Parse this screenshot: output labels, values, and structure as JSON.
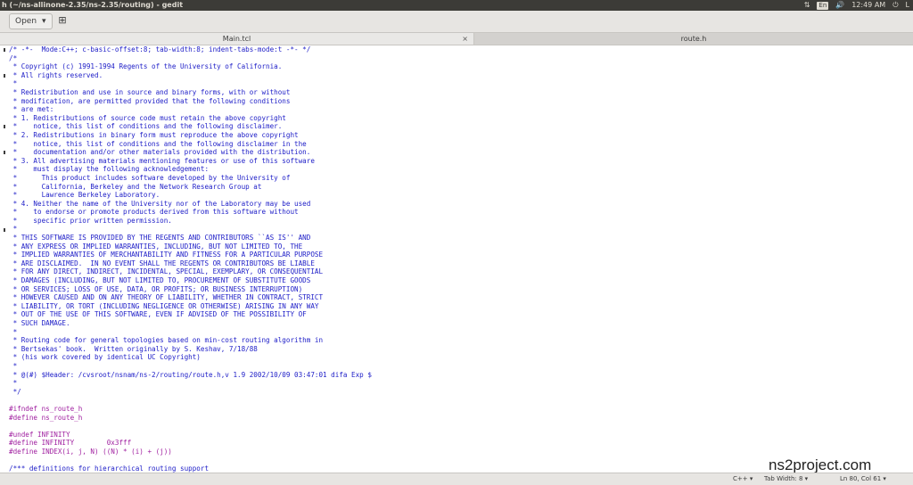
{
  "window": {
    "title": "h (~/ns-allinone-2.35/ns-2.35/routing) - gedit"
  },
  "tray": {
    "sort_icon": "⇅",
    "keyboard": "En",
    "volume_icon": "🔊",
    "time": "12:49 AM",
    "power_icon": "⏻",
    "user_initial": "L"
  },
  "toolbar": {
    "open_label": "Open",
    "open_caret": "▾",
    "new_icon": "⊞"
  },
  "tabs": [
    {
      "label": "Main.tcl",
      "close": "×",
      "active": true
    },
    {
      "label": "route.h",
      "active": false
    }
  ],
  "code_lines": [
    {
      "text": "/* -*-  Mode:C++; c-basic-offset:8; tab-width:8; indent-tabs-mode:t -*- */",
      "kind": "comment"
    },
    {
      "text": "/*",
      "kind": "comment"
    },
    {
      "text": " * Copyright (c) 1991-1994 Regents of the University of California.",
      "kind": "comment"
    },
    {
      "text": " * All rights reserved.",
      "kind": "comment"
    },
    {
      "text": " *",
      "kind": "comment"
    },
    {
      "text": " * Redistribution and use in source and binary forms, with or without",
      "kind": "comment"
    },
    {
      "text": " * modification, are permitted provided that the following conditions",
      "kind": "comment"
    },
    {
      "text": " * are met:",
      "kind": "comment"
    },
    {
      "text": " * 1. Redistributions of source code must retain the above copyright",
      "kind": "comment"
    },
    {
      "text": " *    notice, this list of conditions and the following disclaimer.",
      "kind": "comment"
    },
    {
      "text": " * 2. Redistributions in binary form must reproduce the above copyright",
      "kind": "comment"
    },
    {
      "text": " *    notice, this list of conditions and the following disclaimer in the",
      "kind": "comment"
    },
    {
      "text": " *    documentation and/or other materials provided with the distribution.",
      "kind": "comment"
    },
    {
      "text": " * 3. All advertising materials mentioning features or use of this software",
      "kind": "comment"
    },
    {
      "text": " *    must display the following acknowledgement:",
      "kind": "comment"
    },
    {
      "text": " *      This product includes software developed by the University of",
      "kind": "comment"
    },
    {
      "text": " *      California, Berkeley and the Network Research Group at",
      "kind": "comment"
    },
    {
      "text": " *      Lawrence Berkeley Laboratory.",
      "kind": "comment"
    },
    {
      "text": " * 4. Neither the name of the University nor of the Laboratory may be used",
      "kind": "comment"
    },
    {
      "text": " *    to endorse or promote products derived from this software without",
      "kind": "comment"
    },
    {
      "text": " *    specific prior written permission.",
      "kind": "comment"
    },
    {
      "text": " *",
      "kind": "comment"
    },
    {
      "text": " * THIS SOFTWARE IS PROVIDED BY THE REGENTS AND CONTRIBUTORS ``AS IS'' AND",
      "kind": "comment"
    },
    {
      "text": " * ANY EXPRESS OR IMPLIED WARRANTIES, INCLUDING, BUT NOT LIMITED TO, THE",
      "kind": "comment"
    },
    {
      "text": " * IMPLIED WARRANTIES OF MERCHANTABILITY AND FITNESS FOR A PARTICULAR PURPOSE",
      "kind": "comment"
    },
    {
      "text": " * ARE DISCLAIMED.  IN NO EVENT SHALL THE REGENTS OR CONTRIBUTORS BE LIABLE",
      "kind": "comment"
    },
    {
      "text": " * FOR ANY DIRECT, INDIRECT, INCIDENTAL, SPECIAL, EXEMPLARY, OR CONSEQUENTIAL",
      "kind": "comment"
    },
    {
      "text": " * DAMAGES (INCLUDING, BUT NOT LIMITED TO, PROCUREMENT OF SUBSTITUTE GOODS",
      "kind": "comment"
    },
    {
      "text": " * OR SERVICES; LOSS OF USE, DATA, OR PROFITS; OR BUSINESS INTERRUPTION)",
      "kind": "comment"
    },
    {
      "text": " * HOWEVER CAUSED AND ON ANY THEORY OF LIABILITY, WHETHER IN CONTRACT, STRICT",
      "kind": "comment"
    },
    {
      "text": " * LIABILITY, OR TORT (INCLUDING NEGLIGENCE OR OTHERWISE) ARISING IN ANY WAY",
      "kind": "comment"
    },
    {
      "text": " * OUT OF THE USE OF THIS SOFTWARE, EVEN IF ADVISED OF THE POSSIBILITY OF",
      "kind": "comment"
    },
    {
      "text": " * SUCH DAMAGE.",
      "kind": "comment"
    },
    {
      "text": " *",
      "kind": "comment"
    },
    {
      "text": " * Routing code for general topologies based on min-cost routing algorithm in",
      "kind": "comment"
    },
    {
      "text": " * Bertsekas' book.  Written originally by S. Keshav, 7/18/88",
      "kind": "comment"
    },
    {
      "text": " * (his work covered by identical UC Copyright)",
      "kind": "comment"
    },
    {
      "text": " *",
      "kind": "comment"
    },
    {
      "text": " * @(#) $Header: /cvsroot/nsnam/ns-2/routing/route.h,v 1.9 2002/10/09 03:47:01 difa Exp $",
      "kind": "comment"
    },
    {
      "text": " *",
      "kind": "comment"
    },
    {
      "text": " */",
      "kind": "comment"
    },
    {
      "text": "",
      "kind": "blank"
    },
    {
      "text": "#ifndef ns_route_h",
      "kind": "pre"
    },
    {
      "text": "#define ns_route_h",
      "kind": "pre"
    },
    {
      "text": "",
      "kind": "blank"
    },
    {
      "text": "#undef INFINITY",
      "kind": "pre"
    },
    {
      "text": "#define INFINITY        0x3fff",
      "kind": "pre"
    },
    {
      "text": "#define INDEX(i, j, N) ((N) * (i) + (j))",
      "kind": "pre"
    },
    {
      "text": "",
      "kind": "blank"
    },
    {
      "text": "/*** definitions for hierarchical routing support",
      "kind": "comment"
    }
  ],
  "watermark": "ns2project.com",
  "status": {
    "language": "C++ ▾",
    "tab_width": "Tab Width: 8 ▾",
    "cursor": "Ln 80, Col 61 ▾"
  }
}
